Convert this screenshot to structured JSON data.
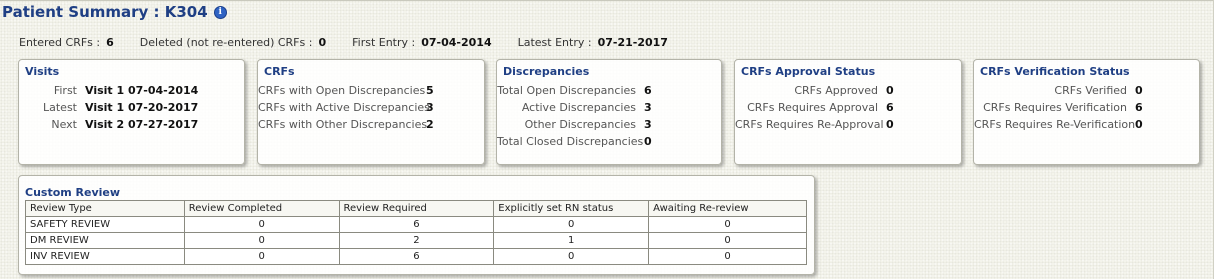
{
  "header": {
    "title": "Patient Summary : K304",
    "info_icon": "info-icon"
  },
  "meta": {
    "entered_crfs_label": "Entered CRFs :",
    "entered_crfs_value": "6",
    "deleted_label": "Deleted (not re-entered) CRFs :",
    "deleted_value": "0",
    "first_entry_label": "First Entry :",
    "first_entry_value": "07-04-2014",
    "latest_entry_label": "Latest Entry :",
    "latest_entry_value": "07-21-2017"
  },
  "visits": {
    "title": "Visits",
    "rows": [
      {
        "label": "First",
        "value": "Visit 1 07-04-2014"
      },
      {
        "label": "Latest",
        "value": "Visit 1 07-20-2017"
      },
      {
        "label": "Next",
        "value": "Visit 2 07-27-2017"
      }
    ]
  },
  "crfs": {
    "title": "CRFs",
    "rows": [
      {
        "label": "CRFs with Open Discrepancies",
        "value": "5"
      },
      {
        "label": "CRFs with Active Discrepancies",
        "value": "3"
      },
      {
        "label": "CRFs with Other Discrepancies",
        "value": "2"
      }
    ]
  },
  "discrepancies": {
    "title": "Discrepancies",
    "rows": [
      {
        "label": "Total Open Discrepancies",
        "value": "6"
      },
      {
        "label": "Active Discrepancies",
        "value": "3"
      },
      {
        "label": "Other Discrepancies",
        "value": "3"
      },
      {
        "label": "Total Closed Discrepancies",
        "value": "0"
      }
    ]
  },
  "approval": {
    "title": "CRFs Approval Status",
    "rows": [
      {
        "label": "CRFs Approved",
        "value": "0"
      },
      {
        "label": "CRFs Requires Approval",
        "value": "6"
      },
      {
        "label": "CRFs Requires Re-Approval",
        "value": "0"
      }
    ]
  },
  "verification": {
    "title": "CRFs Verification Status",
    "rows": [
      {
        "label": "CRFs Verified",
        "value": "0"
      },
      {
        "label": "CRFs Requires Verification",
        "value": "6"
      },
      {
        "label": "CRFs Requires Re-Verification",
        "value": "0"
      }
    ]
  },
  "custom_review": {
    "title": "Custom Review",
    "columns": [
      "Review Type",
      "Review Completed",
      "Review Required",
      "Explicitly set RN status",
      "Awaiting Re-review"
    ],
    "rows": [
      [
        "SAFETY REVIEW",
        "0",
        "6",
        "0",
        "0"
      ],
      [
        "DM REVIEW",
        "0",
        "2",
        "1",
        "0"
      ],
      [
        "INV REVIEW",
        "0",
        "6",
        "0",
        "0"
      ]
    ]
  },
  "colors": {
    "title_blue": "#1f3f84",
    "page_background": "#f4f4ec"
  }
}
